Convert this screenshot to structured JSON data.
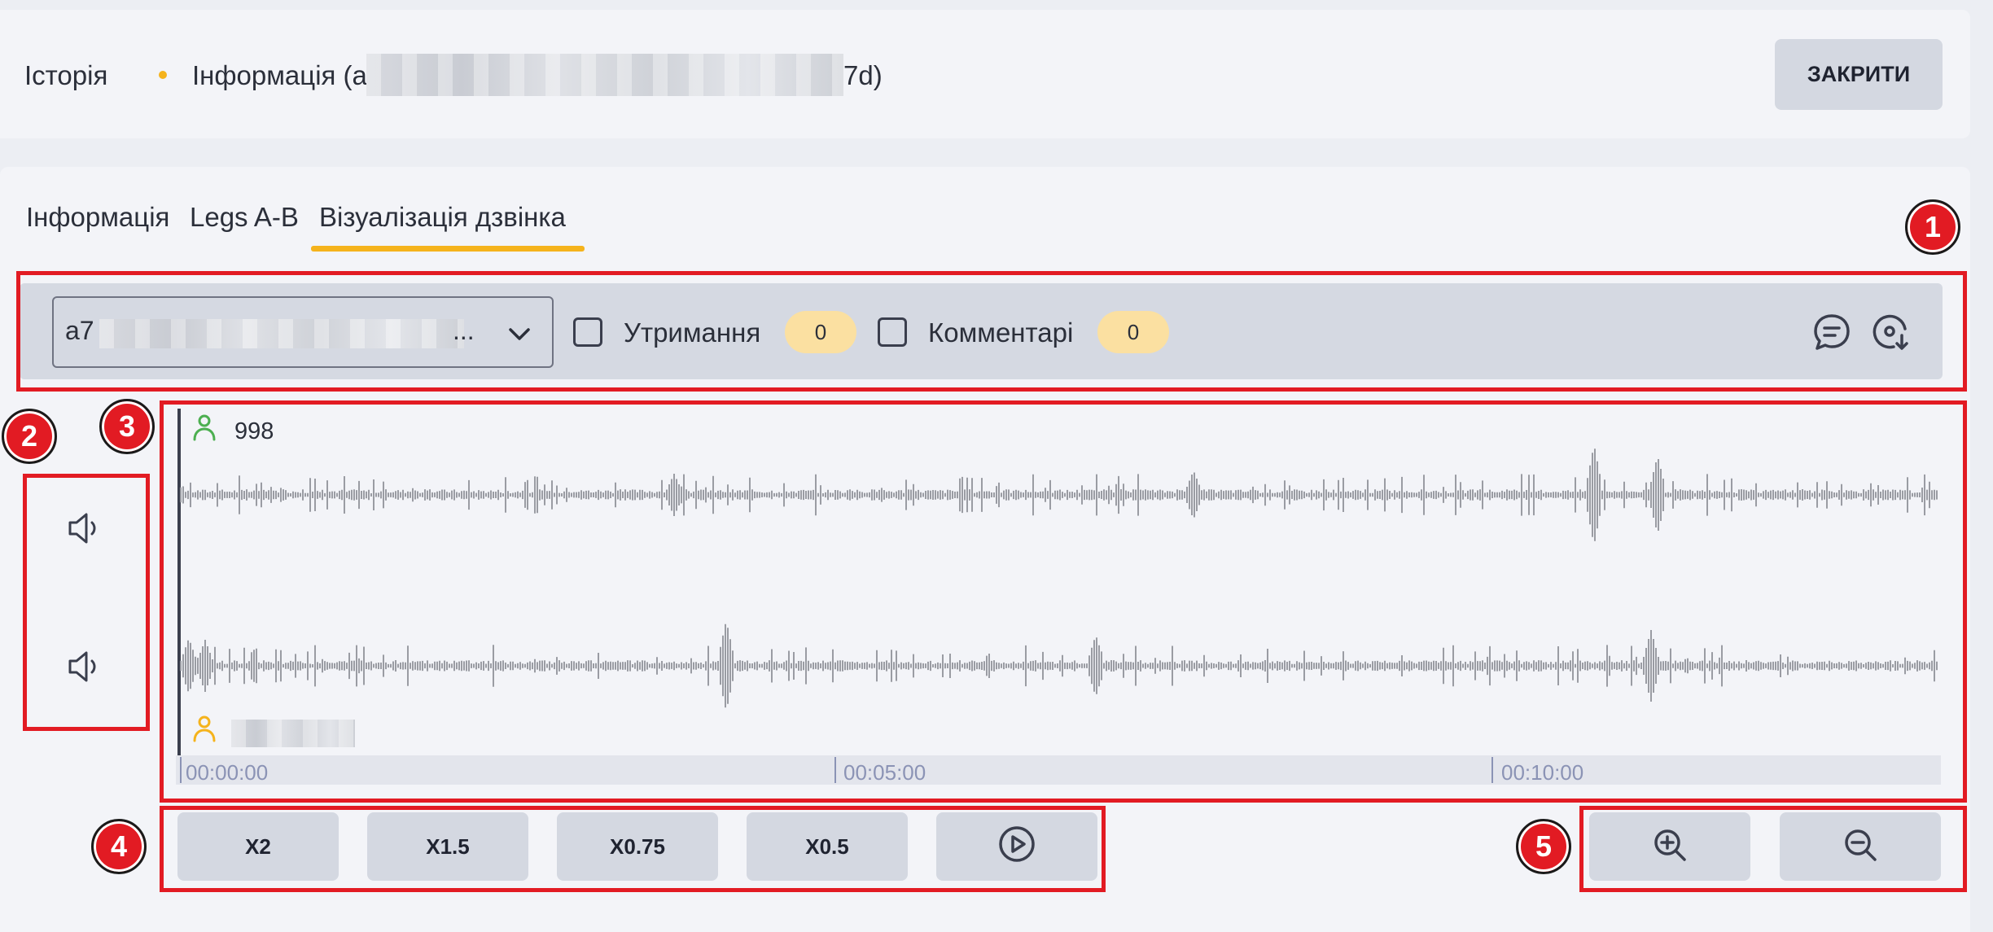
{
  "header": {
    "crumb_history": "Історія",
    "crumb_info_prefix": "Інформація (a",
    "crumb_info_suffix": "7d)",
    "close_button": "ЗАКРИТИ"
  },
  "tabs": [
    {
      "label": "Інформація",
      "active": false
    },
    {
      "label": "Legs A-B",
      "active": false
    },
    {
      "label": "Візуалізація дзвінка",
      "active": true
    }
  ],
  "toolbar": {
    "select_value_prefix": "a7",
    "select_ellipsis": "...",
    "hold_label": "Утримання",
    "hold_count": "0",
    "comments_label": "Комментарі",
    "comments_count": "0",
    "icons": [
      "comment-icon",
      "disc-download-icon"
    ]
  },
  "waveform": {
    "top_speaker": "998",
    "timeline": [
      "00:00:00",
      "00:05:00",
      "00:10:00"
    ]
  },
  "controls": {
    "speeds": [
      "X2",
      "X1.5",
      "X0.75",
      "X0.5"
    ],
    "icons": [
      "play-icon",
      "zoom-in-icon",
      "zoom-out-icon",
      "volume-icon"
    ]
  },
  "annotations": [
    "1",
    "2",
    "3",
    "4",
    "5"
  ],
  "colors": {
    "accent": "#f5b31c",
    "annotation": "#e21b23",
    "speaker_top": "#4caf50",
    "speaker_bottom": "#f5b31c"
  }
}
